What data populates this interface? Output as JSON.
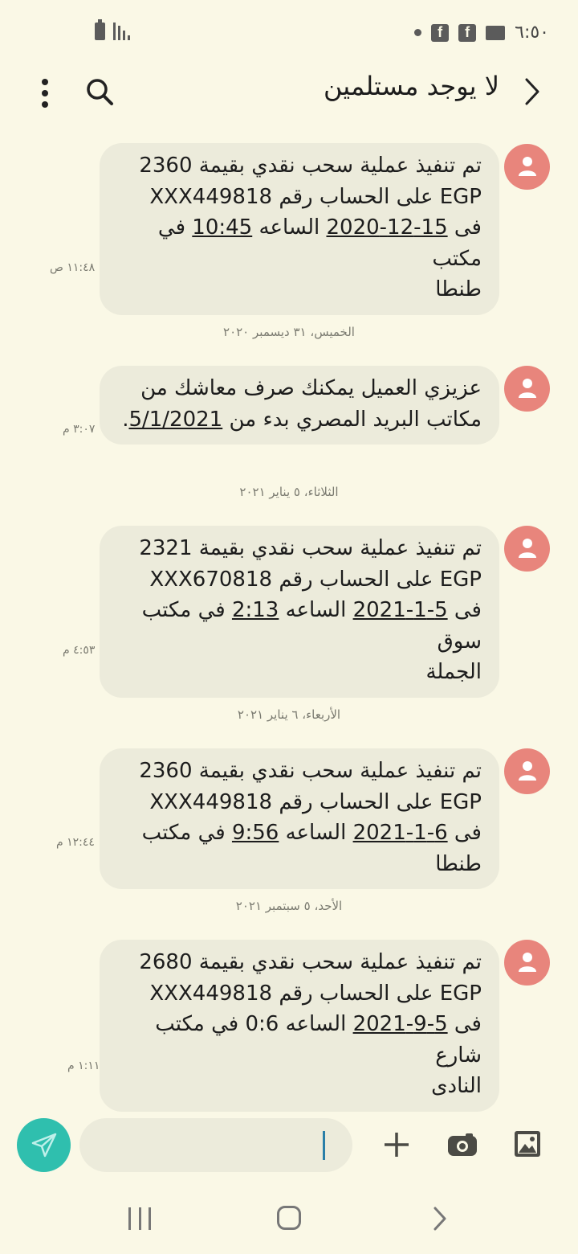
{
  "status_bar": {
    "time": "٦:٥٠",
    "icons": [
      "facebook-icon",
      "facebook-icon",
      "folder-icon",
      "dot-icon",
      "battery-icon",
      "signal-icon"
    ]
  },
  "header": {
    "title": "لا يوجد مستلمين",
    "icons": [
      "back-icon",
      "search-icon",
      "more-options-icon"
    ]
  },
  "messages": [
    {
      "parts": [
        "تم تنفيذ عملية سحب نقدي بقيمة  2360\nEGP  على الحساب رقم   XXX449818\nفى ",
        "15-12-2020",
        " الساعه ",
        "10:45",
        " في مكتب\nطنطا"
      ],
      "time": "١١:٤٨ ص"
    },
    {
      "date_separator": "الخميس، ٣١ ديسمبر ٢٠٢٠",
      "parts": [
        "عزيزي العميل يمكنك صرف معاشك من\nمكاتب البريد المصري بدء من ",
        "5/1/2021",
        "."
      ],
      "time": "٣:٠٧ م"
    },
    {
      "date_separator": "الثلاثاء، ٥ يناير ٢٠٢١",
      "parts": [
        "تم تنفيذ عملية سحب نقدي بقيمة  2321\nEGP  على الحساب رقم   XXX670818\nفى ",
        "5-1-2021",
        " الساعه ",
        "2:13",
        " في مكتب سوق\nالجملة"
      ],
      "time": "٤:٥٣ م"
    },
    {
      "date_separator": "الأربعاء، ٦ يناير ٢٠٢١",
      "parts": [
        "تم تنفيذ عملية سحب نقدي بقيمة  2360\nEGP  على الحساب رقم   XXX449818\nفى ",
        "6-1-2021",
        " الساعه ",
        "9:56",
        " في مكتب طنطا"
      ],
      "time": "١٢:٤٤ م"
    },
    {
      "date_separator": "الأحد، ٥ سبتمبر ٢٠٢١",
      "parts": [
        "تم تنفيذ عملية سحب نقدي بقيمة  2680\nEGP  على الحساب رقم   XXX449818\nفى ",
        "5-9-2021",
        " الساعه 0:6 في مكتب شارع\nالنادى"
      ],
      "time": "١:١١ م"
    }
  ],
  "composer": {
    "input_value": "",
    "icons": [
      "send-icon",
      "add-icon",
      "camera-icon",
      "gallery-icon"
    ],
    "accent_color": "#2fbfae"
  },
  "nav_bar": {
    "icons": [
      "recent-apps-icon",
      "home-icon",
      "back-icon"
    ]
  },
  "colors": {
    "background": "#faf8e6",
    "bubble": "#ecebdb",
    "avatar": "#e8857c"
  }
}
